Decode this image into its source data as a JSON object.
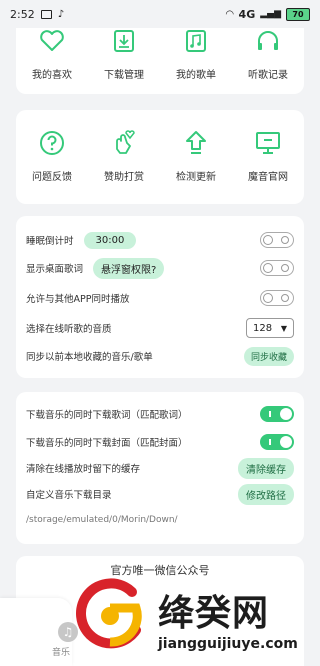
{
  "status_bar": {
    "time": "2:52",
    "notif_icons": [
      "message-icon",
      "tiktok-icon"
    ],
    "network": "4G",
    "battery": "70"
  },
  "colors": {
    "accent": "#35c97a",
    "accent_light": "#c8f1da",
    "background": "#f2f3f5"
  },
  "menu1": [
    {
      "label": "我的喜欢",
      "icon": "heart-icon"
    },
    {
      "label": "下载管理",
      "icon": "download-icon"
    },
    {
      "label": "我的歌单",
      "icon": "playlist-icon"
    },
    {
      "label": "听歌记录",
      "icon": "headphones-icon"
    }
  ],
  "menu2": [
    {
      "label": "问题反馈",
      "icon": "question-icon"
    },
    {
      "label": "赞助打赏",
      "icon": "finger-heart-icon"
    },
    {
      "label": "检测更新",
      "icon": "upload-arrow-icon"
    },
    {
      "label": "魔音官网",
      "icon": "monitor-icon"
    }
  ],
  "settings1": {
    "sleep_timer": {
      "label": "睡眠倒计时",
      "value": "30:00"
    },
    "desktop_lyrics": {
      "label": "显示桌面歌词",
      "badge": "悬浮窗权限?",
      "enabled": false
    },
    "mix_play": {
      "label": "允许与其他APP同时播放",
      "enabled": false
    },
    "quality": {
      "label": "选择在线听歌的音质",
      "value": "128"
    },
    "sync": {
      "label": "同步以前本地收藏的音乐/歌单",
      "button": "同步收藏"
    }
  },
  "settings2": {
    "dl_lyrics": {
      "label": "下载音乐的同时下载歌词（匹配歌词）",
      "enabled": true
    },
    "dl_cover": {
      "label": "下载音乐的同时下载封面（匹配封面）",
      "enabled": true
    },
    "clear_cache": {
      "label": "清除在线播放时留下的缓存",
      "button": "清除缓存"
    },
    "dl_dir": {
      "label": "自定义音乐下载目录",
      "button": "修改路径",
      "path": "/storage/emulated/0/Morin/Down/"
    }
  },
  "bottom": {
    "title": "官方唯一微信公众号"
  },
  "nav": {
    "label": "音乐"
  },
  "watermark": {
    "brand": "绛癸网",
    "domain": "jiangguijiuye.com"
  }
}
